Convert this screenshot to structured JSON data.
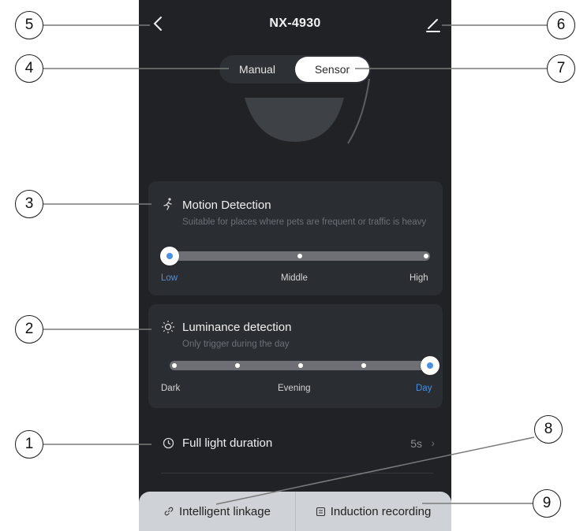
{
  "header": {
    "title": "NX-4930"
  },
  "mode": {
    "tabs": [
      "Manual",
      "Sensor"
    ],
    "selected": "Sensor"
  },
  "motion": {
    "title": "Motion Detection",
    "description": "Suitable for places where pets are frequent or traffic is heavy",
    "scale": [
      "Low",
      "Middle",
      "High"
    ],
    "selected": "Low"
  },
  "luminance": {
    "title": "Luminance detection",
    "description": "Only trigger during the day",
    "scale": [
      "Dark",
      "Evening",
      "Day"
    ],
    "selected": "Day"
  },
  "duration": {
    "label": "Full light duration",
    "value": "5s",
    "chevron": "›"
  },
  "bottom": {
    "left_label": "Intelligent linkage",
    "right_label": "Induction recording"
  },
  "callouts": [
    "1",
    "2",
    "3",
    "4",
    "5",
    "6",
    "7",
    "8",
    "9"
  ],
  "colors": {
    "background": "#202226",
    "card": "#2a2d32",
    "accent": "#4a90e2",
    "bottom_bar": "#cfd2d6"
  }
}
